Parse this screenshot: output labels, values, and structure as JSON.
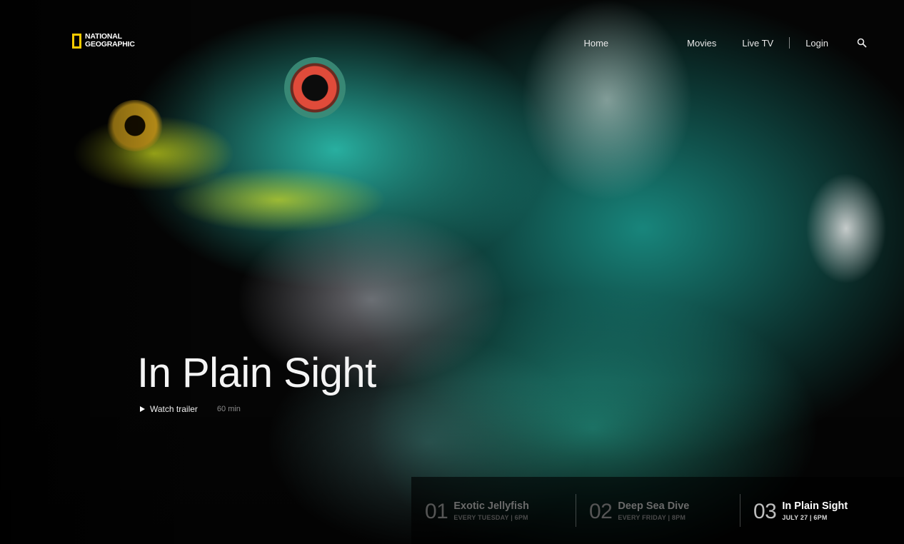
{
  "brand": {
    "line1": "NATIONAL",
    "line2": "GEOGRAPHIC",
    "accent_color": "#ffcc00",
    "logo_icon": "yellow-rectangle-icon"
  },
  "nav": {
    "home": "Home",
    "movies": "Movies",
    "live_tv": "Live TV",
    "login": "Login",
    "search_icon": "search-icon"
  },
  "hero": {
    "title": "In Plain Sight",
    "watch_trailer": "Watch trailer",
    "play_icon": "play-icon",
    "duration": "60 min"
  },
  "episodes": [
    {
      "number": "01",
      "title": "Exotic Jellyfish",
      "schedule": "EVERY TUESDAY | 6PM",
      "active": false
    },
    {
      "number": "02",
      "title": "Deep Sea Dive",
      "schedule": "EVERY FRIDAY | 8PM",
      "active": false
    },
    {
      "number": "03",
      "title": "In Plain Sight",
      "schedule": "JULY 27 | 6PM",
      "active": true
    }
  ]
}
